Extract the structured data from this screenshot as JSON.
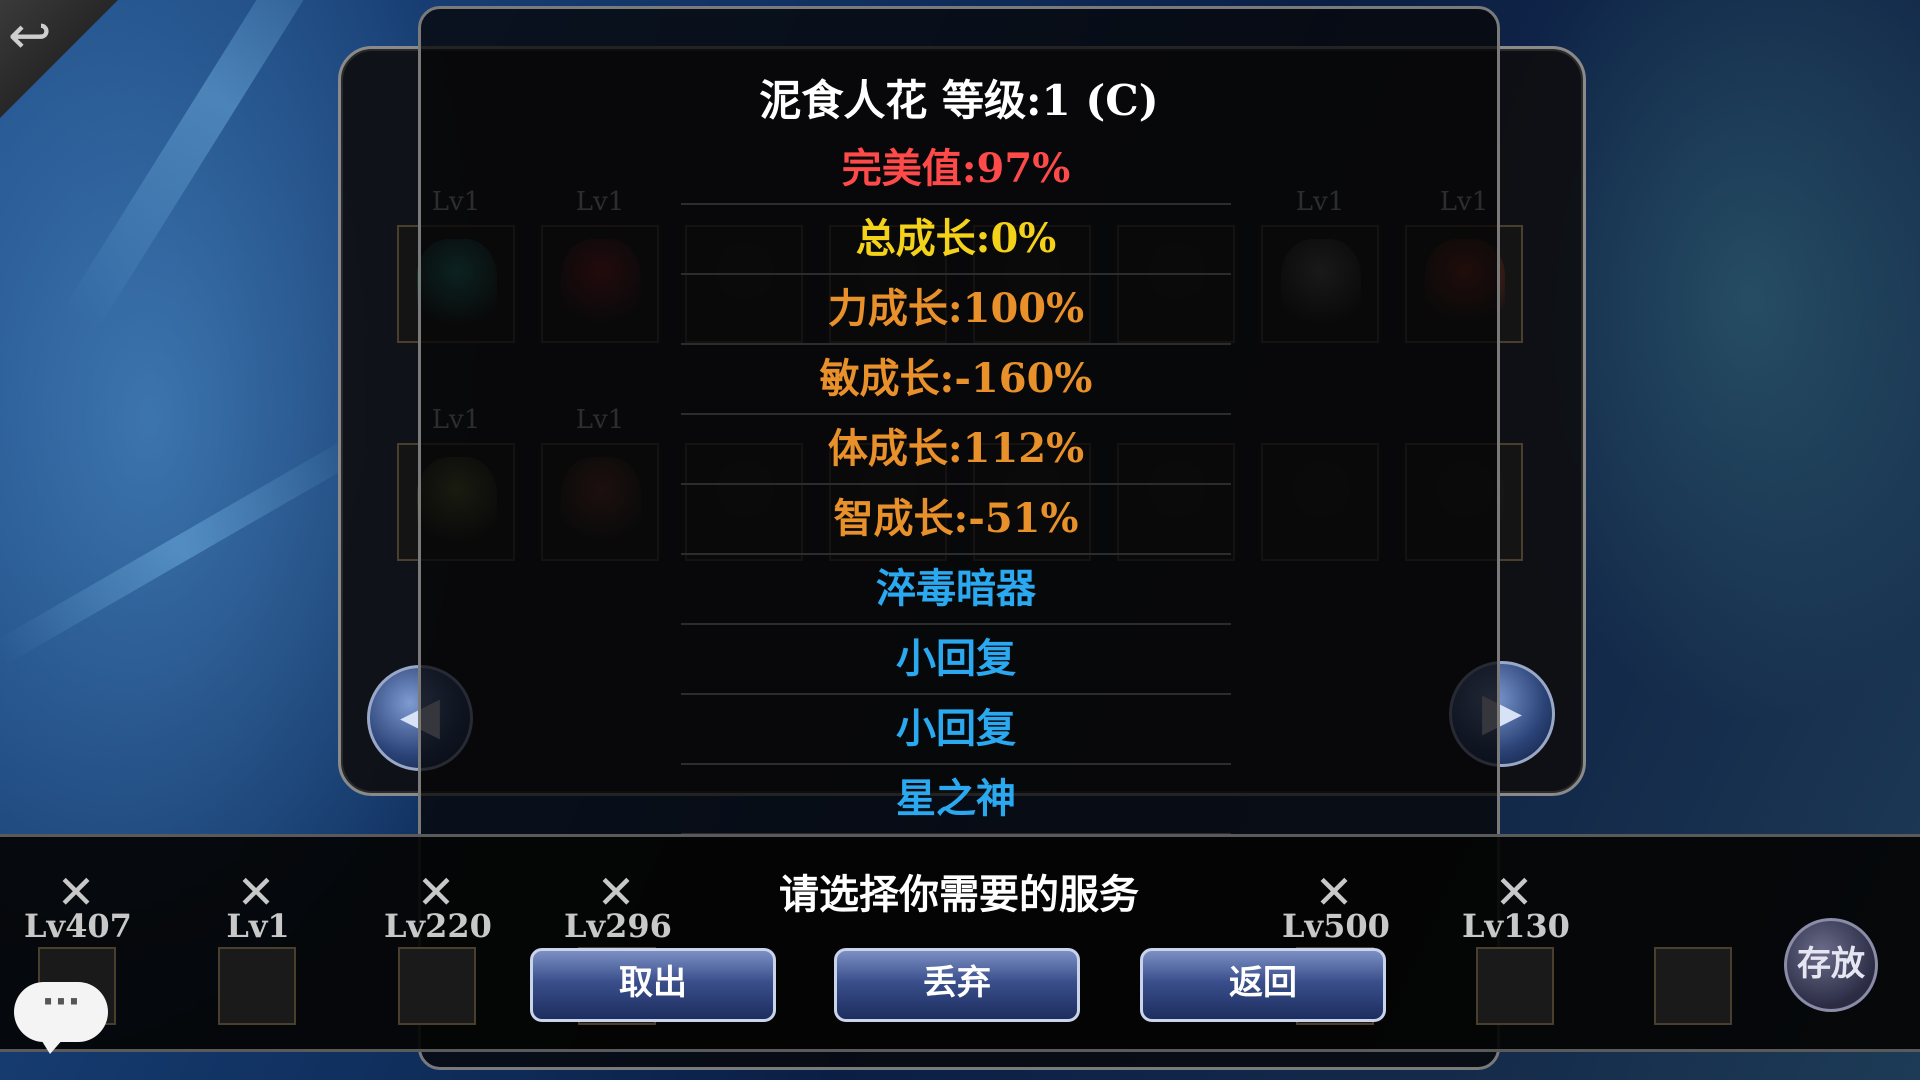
{
  "pet_panel": {
    "top_row": [
      {
        "level": "Lv1",
        "color": "#1f9a8a"
      },
      {
        "level": "Lv1",
        "color": "#9a1c22"
      },
      {
        "level": "",
        "color": "#1a1a1a"
      },
      {
        "level": "",
        "color": "#1a1a1a"
      },
      {
        "level": "",
        "color": "#1a1a1a"
      },
      {
        "level": "",
        "color": "#1a1a1a"
      },
      {
        "level": "Lv1",
        "color": "#6b6b6b"
      },
      {
        "level": "Lv1",
        "color": "#8a2a1a"
      }
    ],
    "bottom_row": [
      {
        "level": "Lv1",
        "color": "#6b7030"
      },
      {
        "level": "Lv1",
        "color": "#7a3a2a"
      },
      {
        "level": "",
        "color": "#1a1a1a"
      },
      {
        "level": "",
        "color": "#1a1a1a"
      },
      {
        "level": "",
        "color": "#1a1a1a"
      },
      {
        "level": "",
        "color": "#1a1a1a"
      },
      {
        "level": "",
        "color": "#1a1a1a"
      },
      {
        "level": "",
        "color": "#1a1a1a"
      }
    ],
    "prev_icon": "chevron-left-icon",
    "next_icon": "chevron-right-icon"
  },
  "popup": {
    "title": "泥食人花 等级:1 (C)",
    "stats": [
      {
        "text": "完美值:97%",
        "color": "#ff4a4a"
      },
      {
        "text": "总成长:0%",
        "color": "#f5d21a"
      },
      {
        "text": "力成长:100%",
        "color": "#e8902a"
      },
      {
        "text": "敏成长:-160%",
        "color": "#e8902a"
      },
      {
        "text": "体成长:112%",
        "color": "#e8902a"
      },
      {
        "text": "智成长:-51%",
        "color": "#e8902a"
      },
      {
        "text": "淬毒暗器",
        "color": "#2aa8f0"
      },
      {
        "text": "小回复",
        "color": "#2aa8f0"
      },
      {
        "text": "小回复",
        "color": "#2aa8f0"
      },
      {
        "text": "星之神",
        "color": "#2aa8f0"
      }
    ]
  },
  "bottom_bar": {
    "service_prompt": "请选择你需要的服务",
    "pets": [
      {
        "x": "✕",
        "level": "Lv407"
      },
      {
        "x": "✕",
        "level": "Lv1"
      },
      {
        "x": "✕",
        "level": "Lv220"
      },
      {
        "x": "✕",
        "level": "Lv296"
      },
      {
        "x": "✕",
        "level": "Lv500"
      },
      {
        "x": "✕",
        "level": "Lv130"
      }
    ],
    "buttons": {
      "take_out": "取出",
      "discard": "丢弃",
      "return": "返回",
      "store": "存放"
    },
    "chat_icon": "chat-bubble-icon",
    "chat_text": "···"
  },
  "back_icon": "back-arrow-icon",
  "back_glyph": "↩"
}
